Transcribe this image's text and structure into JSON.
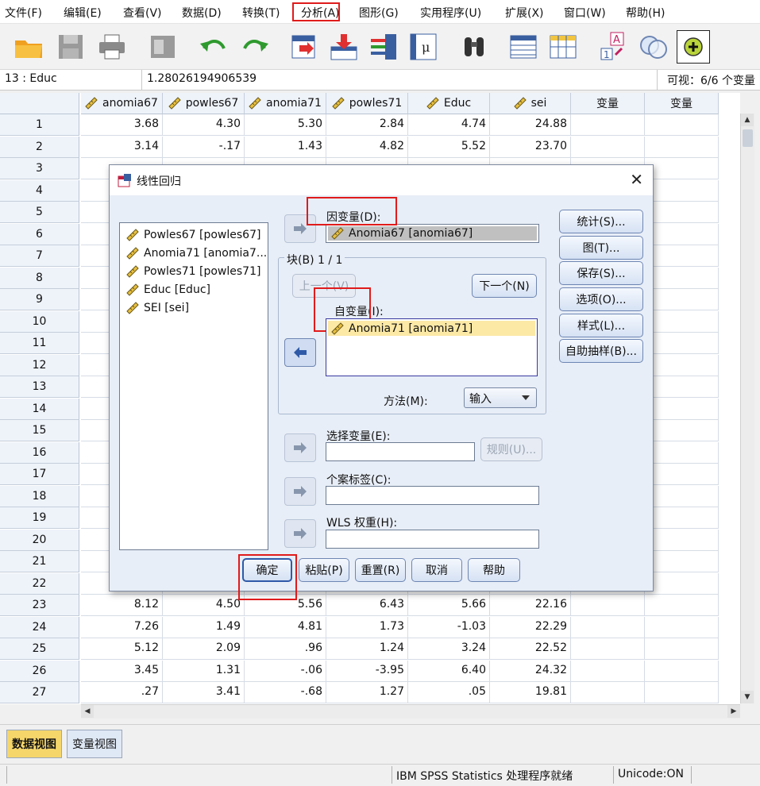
{
  "menu": [
    {
      "label": "文件(F)"
    },
    {
      "label": "编辑(E)"
    },
    {
      "label": "查看(V)"
    },
    {
      "label": "数据(D)"
    },
    {
      "label": "转换(T)"
    },
    {
      "label": "分析(A)"
    },
    {
      "label": "图形(G)"
    },
    {
      "label": "实用程序(U)"
    },
    {
      "label": "扩展(X)"
    },
    {
      "label": "窗口(W)"
    },
    {
      "label": "帮助(H)"
    }
  ],
  "cellbar": {
    "ref": "13 : Educ",
    "value": "1.28026194906539",
    "visible": "可视：6/6 个变量"
  },
  "columns": [
    "anomia67",
    "powles67",
    "anomia71",
    "powles71",
    "Educ",
    "sei",
    "变量",
    "变量"
  ],
  "rows": [
    {
      "n": "1",
      "v": [
        "3.68",
        "4.30",
        "5.30",
        "2.84",
        "4.74",
        "24.88"
      ]
    },
    {
      "n": "2",
      "v": [
        "3.14",
        "-.17",
        "1.43",
        "4.82",
        "5.52",
        "23.70"
      ]
    },
    {
      "n": "3",
      "v": []
    },
    {
      "n": "4",
      "v": []
    },
    {
      "n": "5",
      "v": []
    },
    {
      "n": "6",
      "v": []
    },
    {
      "n": "7",
      "v": []
    },
    {
      "n": "8",
      "v": []
    },
    {
      "n": "9",
      "v": []
    },
    {
      "n": "10",
      "v": []
    },
    {
      "n": "11",
      "v": []
    },
    {
      "n": "12",
      "v": []
    },
    {
      "n": "13",
      "v": []
    },
    {
      "n": "14",
      "v": []
    },
    {
      "n": "15",
      "v": []
    },
    {
      "n": "16",
      "v": []
    },
    {
      "n": "17",
      "v": []
    },
    {
      "n": "18",
      "v": []
    },
    {
      "n": "19",
      "v": []
    },
    {
      "n": "20",
      "v": []
    },
    {
      "n": "21",
      "v": []
    },
    {
      "n": "22",
      "v": []
    },
    {
      "n": "23",
      "v": [
        "8.12",
        "4.50",
        "5.56",
        "6.43",
        "5.66",
        "22.16"
      ]
    },
    {
      "n": "24",
      "v": [
        "7.26",
        "1.49",
        "4.81",
        "1.73",
        "-1.03",
        "22.29"
      ]
    },
    {
      "n": "25",
      "v": [
        "5.12",
        "2.09",
        ".96",
        "1.24",
        "3.24",
        "22.52"
      ]
    },
    {
      "n": "26",
      "v": [
        "3.45",
        "1.31",
        "-.06",
        "-3.95",
        "6.40",
        "24.32"
      ]
    },
    {
      "n": "27",
      "v": [
        ".27",
        "3.41",
        "-.68",
        "1.27",
        ".05",
        "19.81"
      ]
    }
  ],
  "tabs": {
    "data_view": "数据视图",
    "variable_view": "变量视图"
  },
  "status": {
    "processor": "IBM SPSS Statistics 处理程序就绪",
    "unicode": "Unicode:ON"
  },
  "dialog": {
    "title": "线性回归",
    "source_vars": [
      "Powles67 [powles67]",
      "Anomia71 [anomia7...",
      "Powles71 [powles71]",
      "Educ [Educ]",
      "SEI [sei]"
    ],
    "dependent_label": "因变量(D):",
    "dependent_value": "Anomia67 [anomia67]",
    "block_label": "块(B) 1 / 1",
    "prev_button": "上一个(V)",
    "next_button": "下一个(N)",
    "independent_label": "自变量(I):",
    "independent_items": [
      "Anomia71 [anomia71]"
    ],
    "method_label": "方法(M):",
    "method_value": "输入",
    "selection_label": "选择变量(E):",
    "rule_button": "规则(U)...",
    "case_label": "个案标签(C):",
    "wls_label": "WLS 权重(H):",
    "side_buttons": [
      "统计(S)...",
      "图(T)...",
      "保存(S)...",
      "选项(O)...",
      "样式(L)...",
      "自助抽样(B)..."
    ],
    "bottom_buttons": [
      "确定",
      "粘贴(P)",
      "重置(R)",
      "取消",
      "帮助"
    ]
  },
  "colors": {
    "highlight": "#e01b1b",
    "selected_row": "#fce9a6",
    "dependent_fill": "#c0c0c0"
  }
}
